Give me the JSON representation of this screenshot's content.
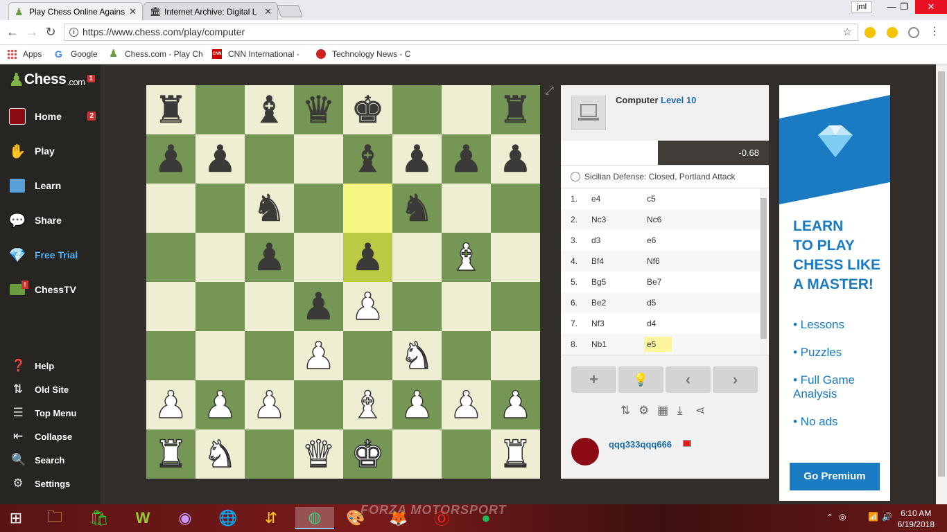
{
  "browser": {
    "tabs": [
      {
        "title": "Play Chess Online Agains",
        "active": true
      },
      {
        "title": "Internet Archive: Digital L",
        "active": false
      }
    ],
    "user_badge": "jml",
    "url": "https://www.chess.com/play/computer",
    "bookmarks": [
      "Apps",
      "Google",
      "Chess.com - Play Ch",
      "CNN International -",
      "Technology News - C"
    ]
  },
  "sidebar": {
    "logo": {
      "text": "Chess",
      "suffix": ".com",
      "badge": "1"
    },
    "items": [
      {
        "label": "Home",
        "badge": "2",
        "icon": "avatar-icon"
      },
      {
        "label": "Play",
        "icon": "play-icon"
      },
      {
        "label": "Learn",
        "icon": "learn-icon"
      },
      {
        "label": "Share",
        "icon": "share-icon"
      },
      {
        "label": "Free Trial",
        "icon": "diamond-icon"
      },
      {
        "label": "ChessTV",
        "icon": "tv-icon"
      }
    ],
    "bottom": [
      {
        "label": "Help",
        "icon": "help-icon"
      },
      {
        "label": "Old Site",
        "icon": "old-site-icon"
      },
      {
        "label": "Top Menu",
        "icon": "menu-icon"
      },
      {
        "label": "Collapse",
        "icon": "collapse-icon"
      },
      {
        "label": "Search",
        "icon": "search-icon"
      },
      {
        "label": "Settings",
        "icon": "gear-icon"
      }
    ]
  },
  "board": {
    "ranks": [
      [
        "r",
        "",
        "b",
        "q",
        "k",
        "",
        "",
        "r"
      ],
      [
        "p",
        "p",
        "",
        "",
        "b",
        "p",
        "p",
        "p"
      ],
      [
        "",
        "",
        "n",
        "",
        "",
        "n",
        "",
        ""
      ],
      [
        "",
        "",
        "p",
        "",
        "p",
        "",
        "B",
        ""
      ],
      [
        "",
        "",
        "",
        "p",
        "P",
        "",
        "",
        ""
      ],
      [
        "",
        "",
        "",
        "P",
        "",
        "N",
        "",
        ""
      ],
      [
        "P",
        "P",
        "P",
        "",
        "B",
        "P",
        "P",
        "P"
      ],
      [
        "R",
        "N",
        "",
        "Q",
        "K",
        "",
        "",
        "R"
      ]
    ],
    "highlight": [
      [
        2,
        4
      ],
      [
        3,
        4
      ]
    ]
  },
  "panel": {
    "opponent_prefix": "Computer",
    "opponent_level": "Level 10",
    "eval": "-0.68",
    "opening": "Sicilian Defense: Closed, Portland Attack",
    "moves": [
      {
        "n": "1.",
        "w": "e4",
        "b": "c5"
      },
      {
        "n": "2.",
        "w": "Nc3",
        "b": "Nc6"
      },
      {
        "n": "3.",
        "w": "d3",
        "b": "e6"
      },
      {
        "n": "4.",
        "w": "Bf4",
        "b": "Nf6"
      },
      {
        "n": "5.",
        "w": "Bg5",
        "b": "Be7"
      },
      {
        "n": "6.",
        "w": "Be2",
        "b": "d5"
      },
      {
        "n": "7.",
        "w": "Nf3",
        "b": "d4"
      },
      {
        "n": "8.",
        "w": "Nb1",
        "b": "e5"
      }
    ],
    "player_name": "qqq333qqq666"
  },
  "ad": {
    "headline": [
      "LEARN",
      "TO PLAY",
      "CHESS LIKE",
      "A MASTER!"
    ],
    "bullets": [
      "• Lessons",
      "• Puzzles",
      "• Full Game Analysis",
      "• No ads"
    ],
    "button": "Go Premium"
  },
  "taskbar": {
    "time": "6:10 AM",
    "date": "6/19/2018",
    "wallpaper_text": "FORZA MOTORSPORT"
  }
}
